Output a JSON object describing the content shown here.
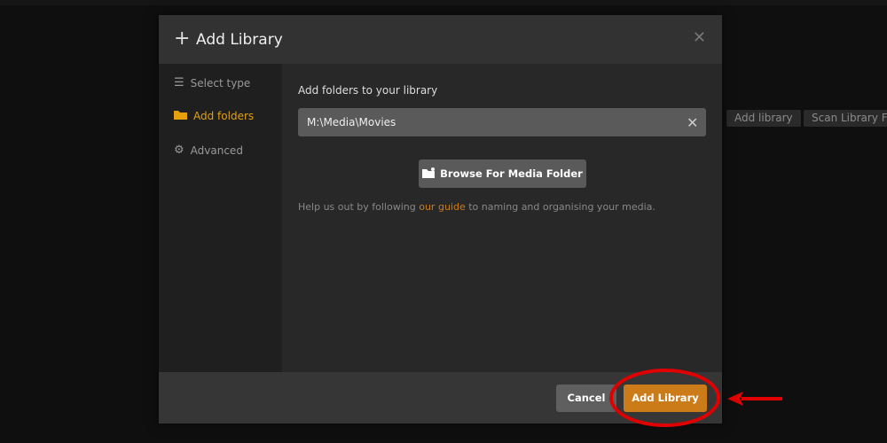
{
  "background": {
    "buttons": [
      "Add library",
      "Scan Library Files"
    ]
  },
  "modal": {
    "title": "Add Library",
    "sidebar": [
      {
        "label": "Select type",
        "icon": "list-icon"
      },
      {
        "label": "Add folders",
        "icon": "folder-icon",
        "active": true
      },
      {
        "label": "Advanced",
        "icon": "gear-icon"
      }
    ],
    "main": {
      "heading": "Add folders to your library",
      "folder_value": "M:\\Media\\Movies",
      "browse_label": "Browse For Media Folder",
      "help_prefix": "Help us out by following ",
      "help_link": "our guide",
      "help_suffix": " to naming and organising your media."
    },
    "footer": {
      "cancel": "Cancel",
      "add": "Add Library"
    }
  },
  "colors": {
    "accent": "#cc7b19",
    "active_nav": "#e5a00d",
    "annotation": "#e00000"
  }
}
